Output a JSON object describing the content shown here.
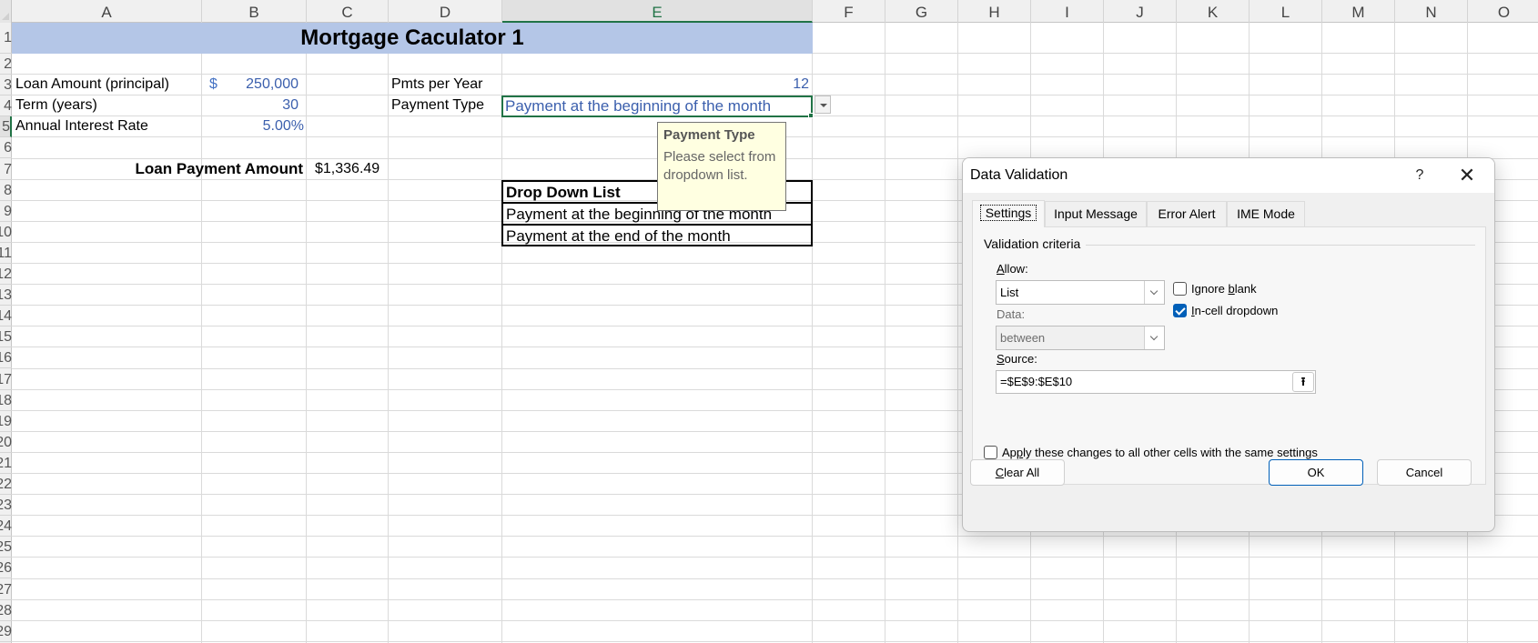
{
  "sheet": {
    "columns": [
      "A",
      "B",
      "C",
      "D",
      "E",
      "F",
      "G",
      "H",
      "I",
      "J",
      "K",
      "L",
      "M",
      "N",
      "O"
    ],
    "active_column": "E",
    "rows_visible": [
      "1",
      "2",
      "3",
      "4",
      "5",
      "6",
      "7",
      "8",
      "9",
      "10",
      "11",
      "12",
      "13",
      "14",
      "15",
      "16",
      "17",
      "18",
      "19",
      "20",
      "21",
      "22",
      "23",
      "24",
      "25",
      "26",
      "27",
      "28",
      "29"
    ],
    "active_row": "5",
    "title": "Mortgage Caculator 1",
    "title_band_color": "#b4c6e7",
    "cells": {
      "A4": "Loan Amount (principal)",
      "B4_currency": "$",
      "B4": "250,000",
      "A5": "Term (years)",
      "B5": "30",
      "A6": "Annual Interest Rate",
      "B6": "5.00%",
      "B8": "Loan Payment Amount",
      "C8": "$1,336.49",
      "D4": "Pmts per Year",
      "E4": "12",
      "D5": "Payment Type",
      "E5": "Payment at the beginning of the month"
    },
    "dropdown_table": {
      "header": "Drop Down List",
      "items": [
        "Payment at the beginning of the month",
        "Payment at the end of the month"
      ]
    },
    "input_tooltip": {
      "title": "Payment Type",
      "message": "Please select from dropdown list."
    }
  },
  "dialog": {
    "title": "Data Validation",
    "help_label": "?",
    "close_label": "✕",
    "tabs": [
      {
        "label": "Settings",
        "active": true
      },
      {
        "label": "Input Message",
        "active": false
      },
      {
        "label": "Error Alert",
        "active": false
      },
      {
        "label": "IME Mode",
        "active": false
      }
    ],
    "group_label": "Validation criteria",
    "allow": {
      "label_u": "A",
      "label_rest": "llow:",
      "value": "List"
    },
    "data": {
      "label": "Data:",
      "value": "between",
      "disabled": true
    },
    "ignore_blank": {
      "label_pre": "Ignore ",
      "label_u": "b",
      "label_post": "lank",
      "checked": false
    },
    "in_cell_dropdown": {
      "label_u": "I",
      "label_rest": "n-cell dropdown",
      "checked": true
    },
    "source": {
      "label_u": "S",
      "label_rest": "ource:",
      "value": "=$E$9:$E$10",
      "collapse_icon": "⭱"
    },
    "apply_all": {
      "label_pre": "Ap",
      "label_u": "p",
      "label_post": "ly these changes to all other cells with the same settings",
      "checked": false
    },
    "buttons": {
      "clear_all_u": "C",
      "clear_all_rest": "lear All",
      "ok": "OK",
      "cancel": "Cancel"
    },
    "accent_color": "#005fb8"
  }
}
